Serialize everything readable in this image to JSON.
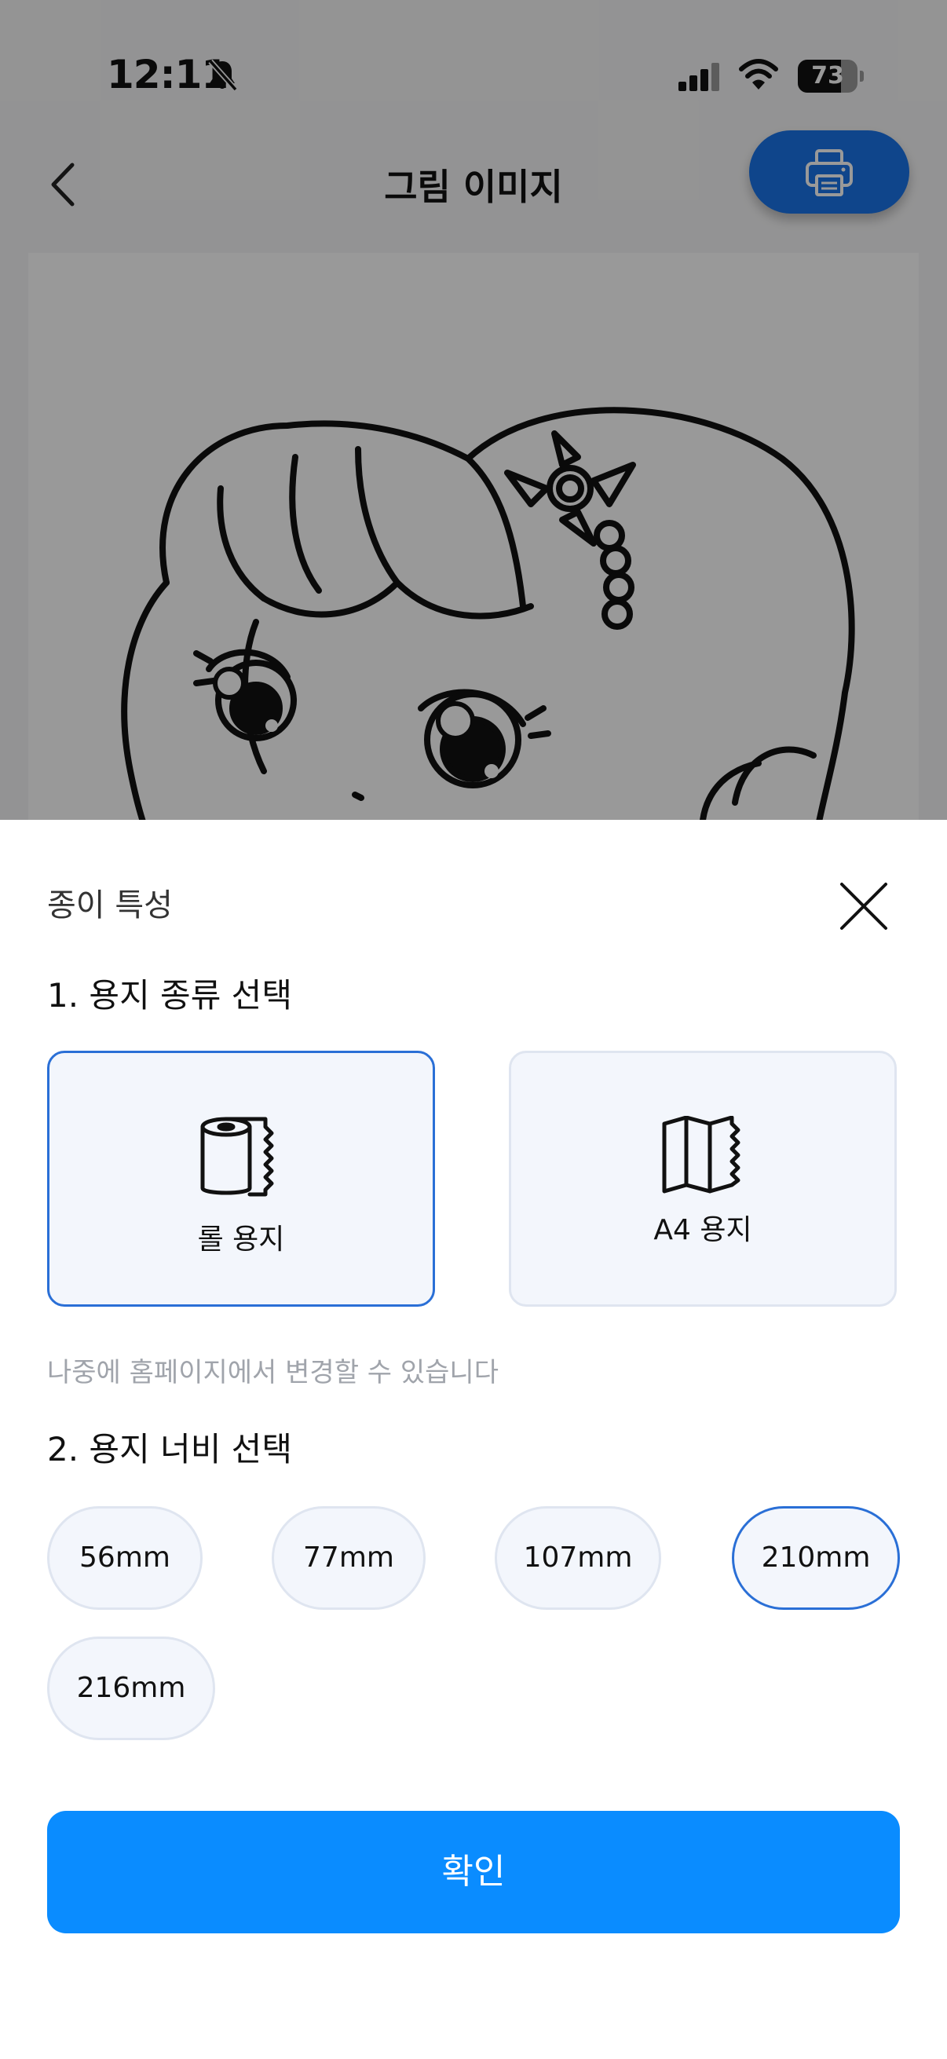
{
  "status_bar": {
    "time": "12:11",
    "battery_percent": "73",
    "battery_level": 0.73,
    "icons": [
      "bell-slash-icon",
      "cellular-signal-icon",
      "wifi-icon",
      "battery-icon"
    ]
  },
  "nav": {
    "title": "그림 이미지",
    "back_icon": "chevron-left-icon",
    "print_icon": "printer-icon"
  },
  "colors": {
    "accent": "#0a8cff",
    "selected_border": "#2a6fd6",
    "option_bg": "#f3f6fc",
    "hint": "#a0a4ab"
  },
  "sheet": {
    "title": "종이 특성",
    "close_icon": "close-icon",
    "section1_title": "1. 용지 종류 선택",
    "paper_types": [
      {
        "label": "롤 용지",
        "icon": "paper-roll-icon",
        "selected": true
      },
      {
        "label": "A4 용지",
        "icon": "folded-paper-icon",
        "selected": false
      }
    ],
    "hint": "나중에 홈페이지에서 변경할 수 있습니다",
    "section2_title": "2. 용지 너비 선택",
    "widths": [
      {
        "label": "56mm",
        "selected": false
      },
      {
        "label": "77mm",
        "selected": false
      },
      {
        "label": "107mm",
        "selected": false
      },
      {
        "label": "210mm",
        "selected": true
      },
      {
        "label": "216mm",
        "selected": false
      }
    ],
    "confirm_label": "확인"
  }
}
